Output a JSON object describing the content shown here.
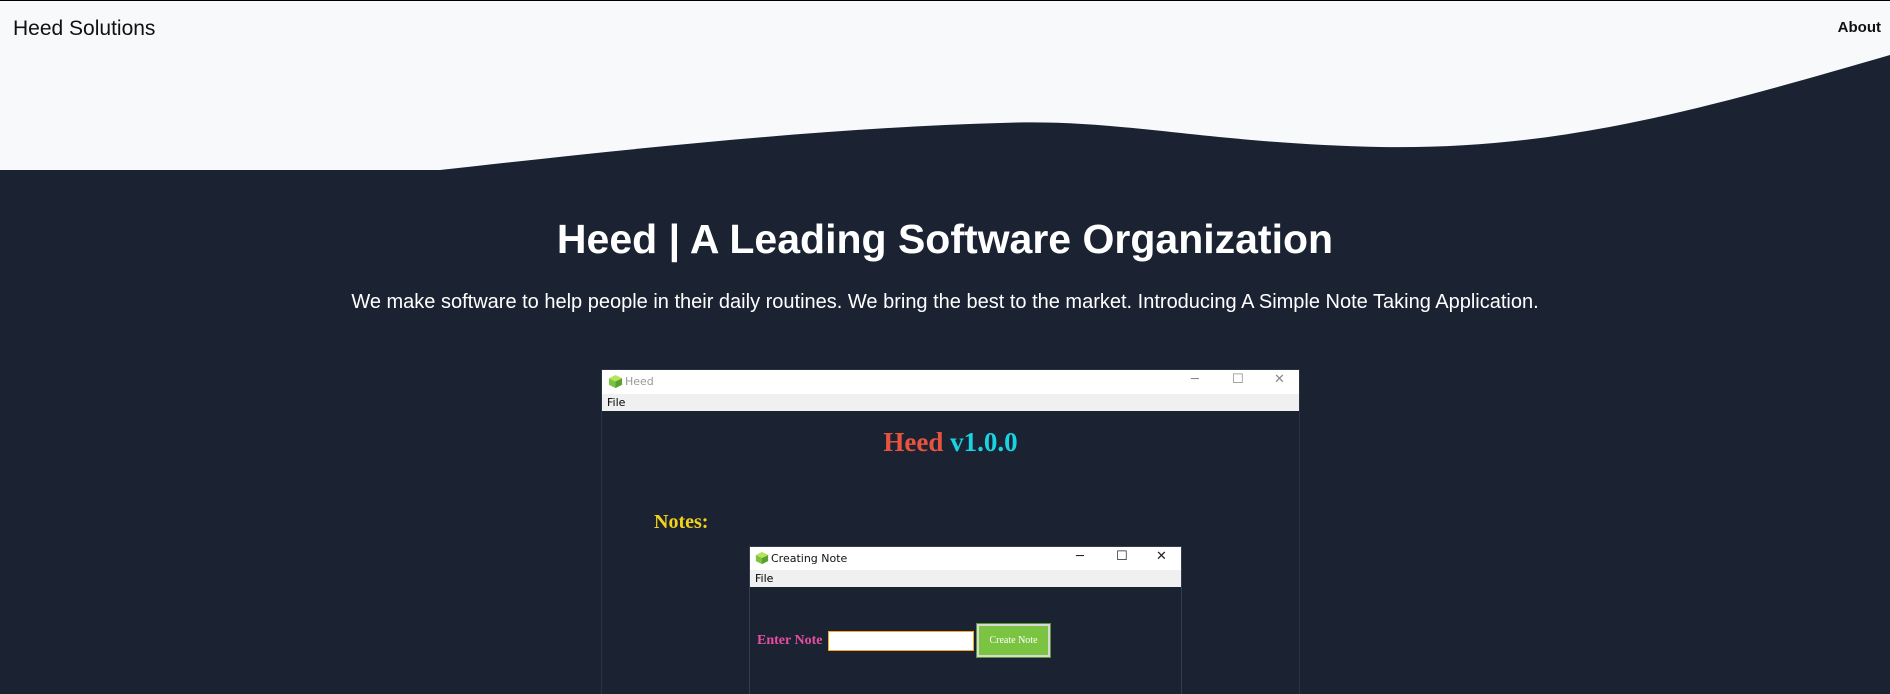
{
  "header": {
    "brand": "Heed Solutions",
    "about_link": "About"
  },
  "colors": {
    "page_bg": "#1b2333",
    "header_bg": "#f8f9fb",
    "accent_red": "#e8533f",
    "accent_cyan": "#1ad2e0",
    "accent_yellow": "#f2d21a",
    "accent_pink": "#e64fa0",
    "button_green": "#7bc441"
  },
  "hero": {
    "title": "Heed | A Leading Software Organization",
    "subtitle": "We make software to help people in their daily routines. We bring the best to the market. Introducing A Simple Note Taking Application."
  },
  "app_window": {
    "title": "Heed",
    "icon": "cube-icon",
    "menu_file": "File",
    "controls": {
      "minimize": "─",
      "maximize": "☐",
      "close": "✕"
    },
    "heading_name": "Heed",
    "heading_version": "v1.0.0",
    "notes_label": "Notes:"
  },
  "dialog": {
    "title": "Creating Note",
    "icon": "cube-icon",
    "menu_file": "File",
    "controls": {
      "minimize": "─",
      "maximize": "☐",
      "close": "✕"
    },
    "enter_label": "Enter Note",
    "input_value": "",
    "create_button": "Create Note"
  }
}
